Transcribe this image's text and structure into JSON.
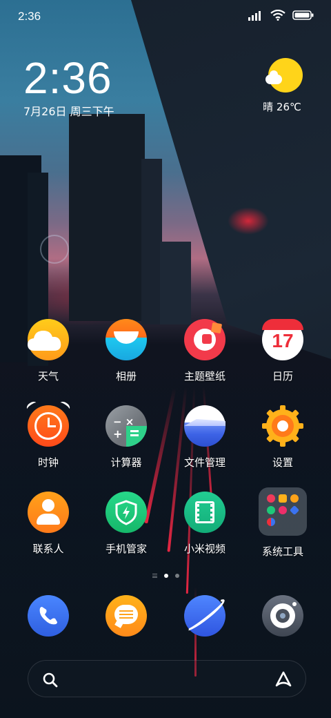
{
  "status_bar": {
    "time": "2:36"
  },
  "clock_widget": {
    "time": "2:36",
    "date": "7月26日 周三下午"
  },
  "weather_widget": {
    "text": "晴 26℃",
    "icon": "sunny-partly-cloudy-icon"
  },
  "apps": [
    [
      {
        "label": "天气",
        "icon": "weather-icon"
      },
      {
        "label": "相册",
        "icon": "gallery-icon"
      },
      {
        "label": "主题壁纸",
        "icon": "themes-icon"
      },
      {
        "label": "日历",
        "icon": "calendar-icon",
        "day": "17"
      }
    ],
    [
      {
        "label": "时钟",
        "icon": "clock-icon"
      },
      {
        "label": "计算器",
        "icon": "calculator-icon"
      },
      {
        "label": "文件管理",
        "icon": "file-manager-icon"
      },
      {
        "label": "设置",
        "icon": "settings-icon"
      }
    ],
    [
      {
        "label": "联系人",
        "icon": "contacts-icon"
      },
      {
        "label": "手机管家",
        "icon": "security-icon"
      },
      {
        "label": "小米视频",
        "icon": "video-icon"
      },
      {
        "label": "系统工具",
        "icon": "system-tools-folder-icon"
      }
    ]
  ],
  "page_indicator": {
    "pages": 2,
    "active": 1
  },
  "dock": [
    {
      "icon": "phone-icon"
    },
    {
      "icon": "messages-icon"
    },
    {
      "icon": "browser-icon"
    },
    {
      "icon": "camera-icon"
    }
  ],
  "search_bar": {
    "left_icon": "search-icon",
    "right_icon": "assistant-icon"
  },
  "colors": {
    "weather_yellow": "#ffd41a",
    "gallery_orange": "#ff7a1a",
    "gallery_blue": "#1ec8f0",
    "calendar_red": "#ee2e3a",
    "clock_orange": "#ff5a1a",
    "calc_gray": "#7a7f86",
    "calc_green": "#2ed18a",
    "file_blue": "#3d63e6",
    "settings_yellow": "#ffb11a",
    "contacts_orange": "#ff8a1a",
    "security_green": "#1ec878",
    "video_green": "#19c08a",
    "phone_blue": "#3b73f0",
    "messages_orange": "#ffa31a",
    "browser_blue": "#3b6bf0",
    "camera_gray": "#5a6270"
  }
}
